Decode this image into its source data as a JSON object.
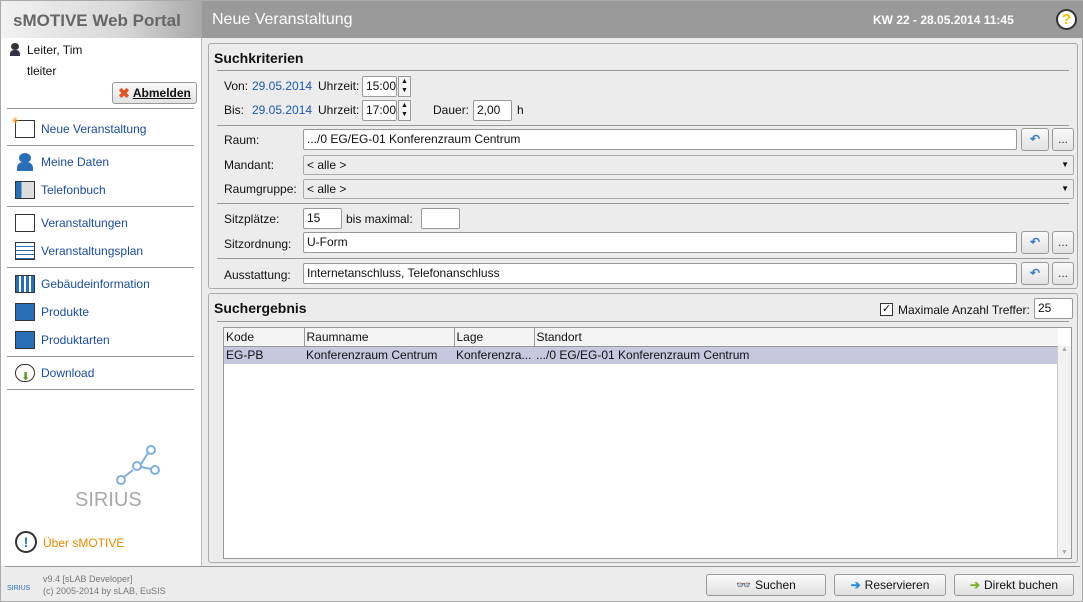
{
  "header": {
    "brand": "sMOTIVE Web Portal",
    "title": "Neue Veranstaltung",
    "datetime": "KW 22 - 28.05.2014 11:45",
    "help": "?"
  },
  "user": {
    "name": "Leiter, Tim",
    "login": "tleiter",
    "logout": "Abmelden"
  },
  "sidebar": {
    "items": [
      {
        "label": "Neue Veranstaltung",
        "icon": "presentation-new-icon"
      },
      {
        "label": "Meine Daten",
        "icon": "user-icon"
      },
      {
        "label": "Telefonbuch",
        "icon": "phonebook-icon"
      },
      {
        "label": "Veranstaltungen",
        "icon": "presentation-icon"
      },
      {
        "label": "Veranstaltungsplan",
        "icon": "schedule-icon"
      },
      {
        "label": "Gebäudeinformation",
        "icon": "building-icon"
      },
      {
        "label": "Produkte",
        "icon": "product-icon"
      },
      {
        "label": "Produktarten",
        "icon": "product-types-icon"
      },
      {
        "label": "Download",
        "icon": "download-icon"
      }
    ],
    "logo": "SIRIUS",
    "about": "Über sMOTIVE"
  },
  "search": {
    "title": "Suchkriterien",
    "von_label": "Von:",
    "von_date": "29.05.2014",
    "uhrzeit_label": "Uhrzeit:",
    "von_time": "15:00",
    "bis_label": "Bis:",
    "bis_date": "29.05.2014",
    "bis_time": "17:00",
    "dauer_label": "Dauer:",
    "dauer": "2,00",
    "dauer_unit": "h",
    "raum_label": "Raum:",
    "raum": ".../0 EG/EG-01 Konferenzraum Centrum",
    "mandant_label": "Mandant:",
    "mandant": "< alle >",
    "raumgruppe_label": "Raumgruppe:",
    "raumgruppe": "< alle >",
    "sitz_label": "Sitzplätze:",
    "sitz": "15",
    "max_label": "bis maximal:",
    "max": "",
    "sitzordnung_label": "Sitzordnung:",
    "sitzordnung": "U-Form",
    "ausstattung_label": "Ausstattung:",
    "ausstattung": "Internetanschluss, Telefonanschluss",
    "more": "..."
  },
  "results": {
    "title": "Suchergebnis",
    "max_hits_label": "Maximale Anzahl Treffer:",
    "max_hits": "25",
    "max_hits_checked": true,
    "columns": [
      "Kode",
      "Raumname",
      "Lage",
      "Standort"
    ],
    "rows": [
      [
        "EG-PB",
        "Konferenzraum Centrum",
        "Konferenzra...",
        ".../0 EG/EG-01 Konferenzraum Centrum"
      ]
    ]
  },
  "footer": {
    "version": "v9.4 [sLAB Developer]",
    "copyright": "(c) 2005-2014 by sLAB, EuSIS",
    "logo": "SIRIUS"
  },
  "actions": {
    "search": "Suchen",
    "reserve": "Reservieren",
    "book": "Direkt buchen"
  }
}
